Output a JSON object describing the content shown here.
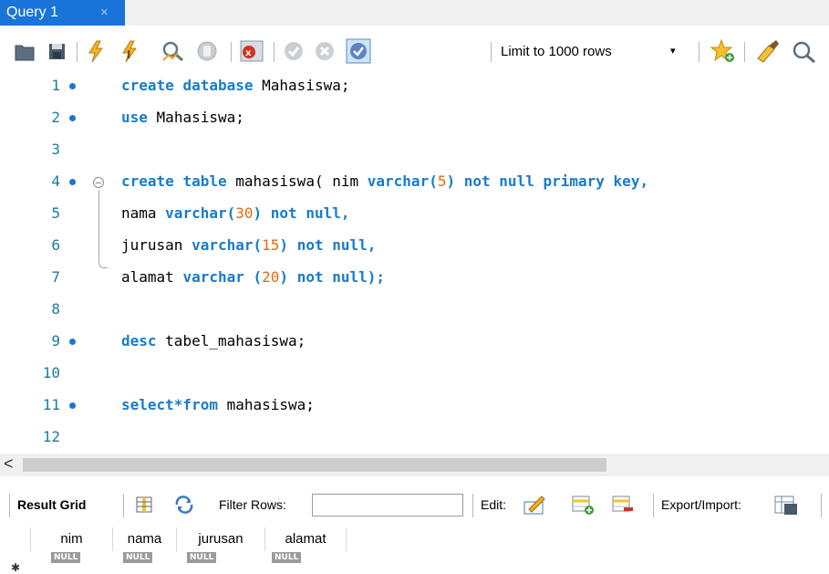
{
  "tab": {
    "title": "Query 1",
    "close": "×"
  },
  "toolbar": {
    "icons": [
      "open-folder-icon",
      "save-icon",
      "execute-icon",
      "execute-current-icon",
      "explain-icon",
      "stop-icon",
      "toggle-error-icon",
      "commit-icon",
      "rollback-icon",
      "autocommit-icon",
      "limit-rows-select",
      "add-snippet-icon",
      "beautify-icon",
      "find-icon"
    ],
    "limit_label": "Limit to 1000 rows",
    "caret": "▾"
  },
  "editor": {
    "lines": [
      {
        "n": "1",
        "dot": true
      },
      {
        "n": "2",
        "dot": true
      },
      {
        "n": "3",
        "dot": false
      },
      {
        "n": "4",
        "dot": true
      },
      {
        "n": "5",
        "dot": false
      },
      {
        "n": "6",
        "dot": false
      },
      {
        "n": "7",
        "dot": false
      },
      {
        "n": "8",
        "dot": false
      },
      {
        "n": "9",
        "dot": true
      },
      {
        "n": "10",
        "dot": false
      },
      {
        "n": "11",
        "dot": true
      },
      {
        "n": "12",
        "dot": false
      }
    ],
    "tokens": {
      "l1": [
        "create",
        "database",
        "Mahasiswa;"
      ],
      "l2": [
        "use",
        "Mahasiswa;"
      ],
      "l4": [
        "create",
        "table",
        "mahasiswa(",
        "nim",
        "varchar(",
        "5",
        ")",
        "not",
        "null",
        "primary",
        "key,"
      ],
      "l5": [
        "nama",
        "varchar(",
        "30",
        ")",
        "not",
        "null,"
      ],
      "l6": [
        "jurusan",
        "varchar(",
        "15",
        ")",
        "not",
        "null,"
      ],
      "l7": [
        "alamat",
        "varchar",
        "(",
        "20",
        ")",
        "not",
        "null);"
      ],
      "l9": [
        "desc",
        "tabel_mahasiswa;"
      ],
      "l11": [
        "select*from",
        "mahasiswa;"
      ]
    }
  },
  "scroll": {
    "left_arrow": "<"
  },
  "results": {
    "result_grid": "Result Grid",
    "filter_rows": "Filter Rows:",
    "edit": "Edit:",
    "export_import": "Export/Import:",
    "columns": [
      "nim",
      "nama",
      "jurusan",
      "alamat"
    ],
    "null_value": "NULL",
    "row_marker": "✱"
  },
  "colors": {
    "accent": "#1a73d8",
    "keyword": "#1a7bc8",
    "number": "#e06b14",
    "line_number": "#1f7a98"
  }
}
